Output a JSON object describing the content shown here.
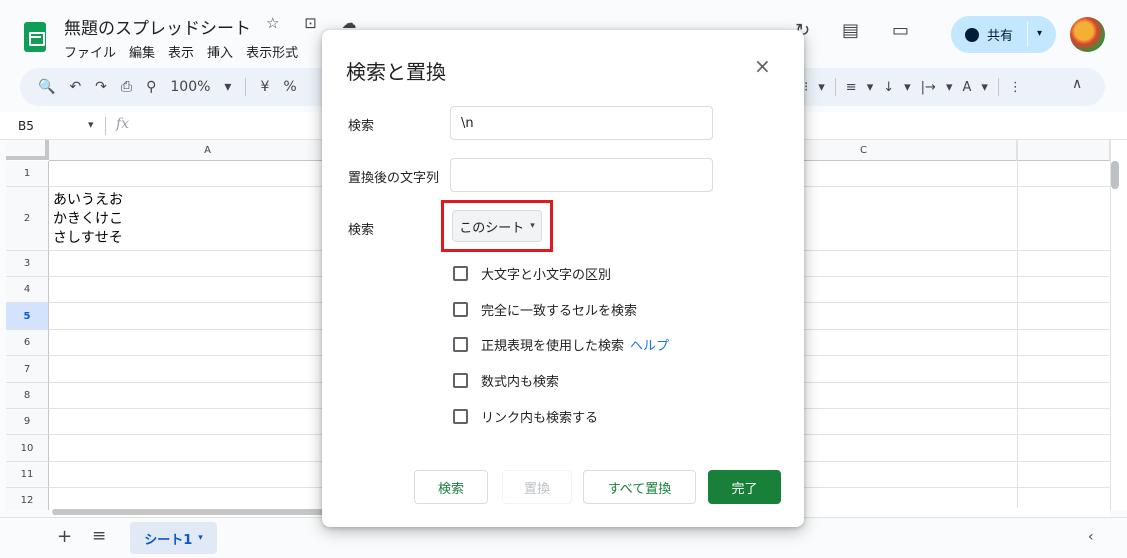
{
  "header": {
    "doc_title": "無題のスプレッドシート",
    "title_icons": "☆ ⊡ ☁",
    "menu": [
      "ファイル",
      "編集",
      "表示",
      "挿入",
      "表示形式"
    ],
    "history_icon": "↻",
    "comment_icon": "▤",
    "meet_icon": "▭",
    "share_label": "共有",
    "share_caret": "▾"
  },
  "toolbar": {
    "left_items": [
      "🔍",
      "↶",
      "↷",
      "⎙",
      "⚲",
      "100%",
      "▾",
      "|",
      "¥",
      "%"
    ],
    "right_items": [
      "⁝⁝",
      "▾",
      "|",
      "≡",
      "▾",
      "↓",
      "▾",
      "|→",
      "▾",
      "A",
      "▾",
      "|",
      "⋮"
    ],
    "collapse_icon": "∧"
  },
  "formula_bar": {
    "cell_ref": "B5",
    "caret": "▾",
    "fx": "fx"
  },
  "grid": {
    "columns": [
      "A",
      "C"
    ],
    "rows": [
      "1",
      "2",
      "3",
      "4",
      "5",
      "6",
      "7",
      "8",
      "9",
      "10",
      "11",
      "12"
    ],
    "active_row": "5",
    "cell_a2": "あいうえお\nかきくけこ\nさしすせそ"
  },
  "sheets": {
    "add": "+",
    "all": "≡",
    "tab_label": "シート1",
    "tab_caret": "▾",
    "nav": "‹"
  },
  "dialog": {
    "title": "検索と置換",
    "close": "×",
    "find_label": "検索",
    "find_value": "\\n",
    "replace_label": "置換後の文字列",
    "replace_value": "",
    "scope_label": "検索",
    "scope_value": "このシート",
    "scope_caret": "▾",
    "options": [
      {
        "label": "大文字と小文字の区別",
        "checked": false
      },
      {
        "label": "完全に一致するセルを検索",
        "checked": false
      },
      {
        "label": "正規表現を使用した検索",
        "checked": false,
        "link": "ヘルプ"
      },
      {
        "label": "数式内も検索",
        "checked": false
      },
      {
        "label": "リンク内も検索する",
        "checked": false
      }
    ],
    "buttons": {
      "find": "検索",
      "replace": "置換",
      "replace_all": "すべて置換",
      "done": "完了"
    }
  },
  "colors": {
    "accent_green": "#188038",
    "share_bg": "#c2e7ff",
    "highlight_red": "#e0191f",
    "active_row_bg": "#d3e3fd"
  }
}
